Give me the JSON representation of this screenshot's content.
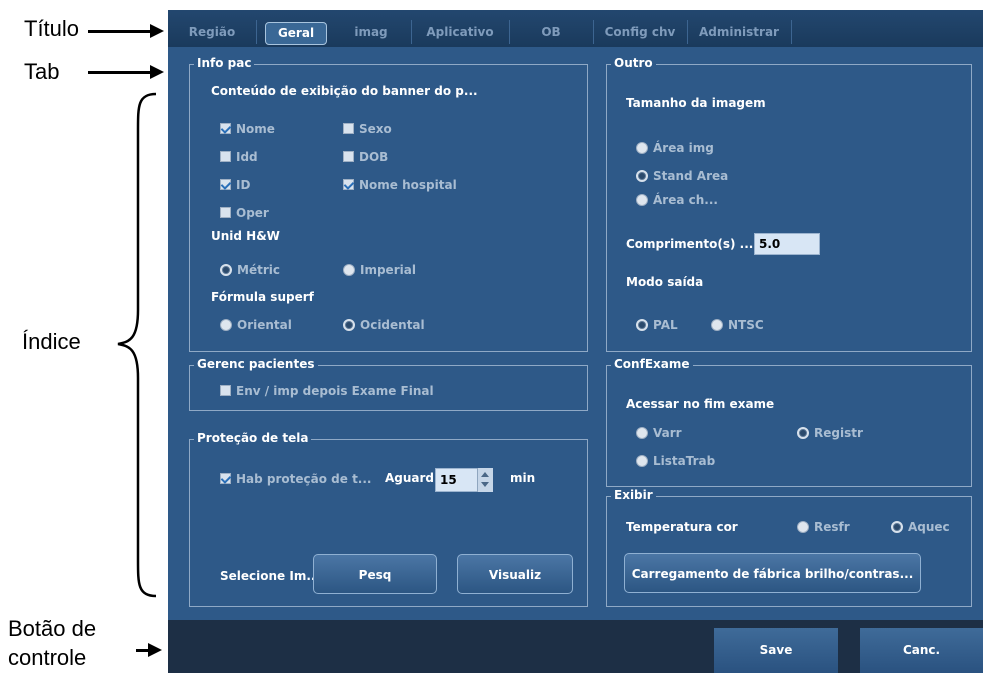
{
  "annotations": {
    "title": "Título",
    "tab": "Tab",
    "index": "Índice",
    "control_line1": "Botão de",
    "control_line2": "controle"
  },
  "tabs": [
    "Região",
    "Geral",
    "imag",
    "Aplicativo",
    "OB",
    "Config chv",
    "Administrar"
  ],
  "active_tab": "Geral",
  "info_pac": {
    "title": "Info pac",
    "banner_label": "Conteúdo de exibição do banner do p...",
    "checkboxes": [
      {
        "label": "Nome",
        "checked": true
      },
      {
        "label": "Sexo",
        "checked": false
      },
      {
        "label": "Idd",
        "checked": false
      },
      {
        "label": "DOB",
        "checked": false
      },
      {
        "label": "ID",
        "checked": true
      },
      {
        "label": "Nome hospital",
        "checked": true
      },
      {
        "label": "Oper",
        "checked": false
      }
    ],
    "unit_label": "Unid H&W",
    "unit_options": [
      {
        "label": "Métric",
        "selected": true
      },
      {
        "label": "Imperial",
        "selected": false
      }
    ],
    "formula_label": "Fórmula superf",
    "formula_options": [
      {
        "label": "Oriental",
        "selected": false
      },
      {
        "label": "Ocidental",
        "selected": true
      }
    ]
  },
  "gerenc": {
    "title": "Gerenc pacientes",
    "checkbox_label": "Env / imp depois Exame Final",
    "checked": false
  },
  "protecao": {
    "title": "Proteção de tela",
    "enable_label": "Hab proteção de t...",
    "enabled": true,
    "wait_label": "Aguard",
    "wait_value": "15",
    "unit": "min",
    "select_label": "Selecione Im...",
    "browse_button": "Pesq",
    "preview_button": "Visualiz"
  },
  "outro": {
    "title": "Outro",
    "image_size_label": "Tamanho da imagem",
    "image_size_options": [
      {
        "label": "Área img",
        "selected": false
      },
      {
        "label": "Stand Area",
        "selected": true
      },
      {
        "label": "Área ch...",
        "selected": false
      }
    ],
    "length_label": "Comprimento(s) ...",
    "length_value": "5.0",
    "output_label": "Modo saída",
    "output_options": [
      {
        "label": "PAL",
        "selected": true
      },
      {
        "label": "NTSC",
        "selected": false
      }
    ]
  },
  "confexame": {
    "title": "ConfExame",
    "end_label": "Acessar no fim exame",
    "options": [
      {
        "label": "Varr",
        "selected": false
      },
      {
        "label": "Registr",
        "selected": true
      },
      {
        "label": "ListaTrab",
        "selected": false
      }
    ]
  },
  "exibir": {
    "title": "Exibir",
    "temp_label": "Temperatura cor",
    "temp_options": [
      {
        "label": "Resfr",
        "selected": false
      },
      {
        "label": "Aquec",
        "selected": true
      }
    ],
    "factory_button": "Carregamento de fábrica brilho/contras..."
  },
  "controls": {
    "save": "Save",
    "cancel": "Canc."
  },
  "colors": {
    "panel": "#2e5988",
    "tabbar": "#1a3a5c",
    "control_bar": "#1d2f45",
    "button": "#3f6b99"
  }
}
